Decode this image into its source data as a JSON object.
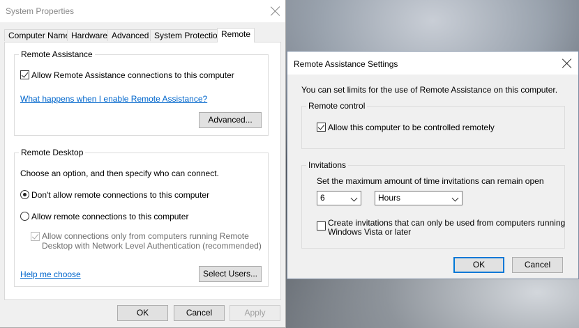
{
  "system_properties": {
    "title": "System Properties",
    "tabs": [
      {
        "label": "Computer Name",
        "active": false
      },
      {
        "label": "Hardware",
        "active": false
      },
      {
        "label": "Advanced",
        "active": false
      },
      {
        "label": "System Protection",
        "active": false
      },
      {
        "label": "Remote",
        "active": true
      }
    ],
    "remote_assistance": {
      "group_label": "Remote Assistance",
      "allow_label": "Allow Remote Assistance connections to this computer",
      "allow_checked": true,
      "help_link": "What happens when I enable Remote Assistance?",
      "advanced_button": "Advanced..."
    },
    "remote_desktop": {
      "group_label": "Remote Desktop",
      "instructions": "Choose an option, and then specify who can connect.",
      "option_dont_allow": "Don't allow remote connections to this computer",
      "option_allow": "Allow remote connections to this computer",
      "selected_option": "dont_allow",
      "nla_line1": "Allow connections only from computers running Remote",
      "nla_line2": "Desktop with Network Level Authentication (recommended)",
      "nla_checked": true,
      "help_link": "Help me choose",
      "select_users_button": "Select Users..."
    },
    "buttons": {
      "ok": "OK",
      "cancel": "Cancel",
      "apply": "Apply"
    }
  },
  "remote_assistance_settings": {
    "title": "Remote Assistance Settings",
    "intro": "You can set limits for the use of Remote Assistance on this computer.",
    "remote_control": {
      "group_label": "Remote control",
      "allow_label": "Allow this computer to be controlled remotely",
      "allow_checked": true
    },
    "invitations": {
      "group_label": "Invitations",
      "max_time_label": "Set the maximum amount of time invitations can remain open",
      "amount_value": "6",
      "unit_value": "Hours",
      "vista_line1": "Create invitations that can only be used from computers running",
      "vista_line2": "Windows Vista or later",
      "vista_checked": false
    },
    "buttons": {
      "ok": "OK",
      "cancel": "Cancel"
    }
  },
  "colors": {
    "link": "#0066cc",
    "default_button_border": "#0078d7"
  }
}
